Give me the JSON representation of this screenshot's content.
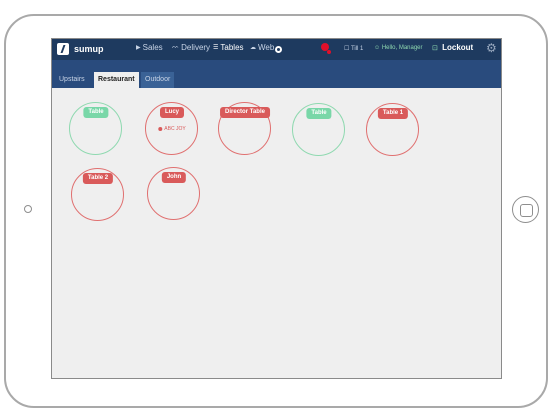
{
  "brand": {
    "logo_text": "sumup"
  },
  "nav": {
    "sales": "Sales",
    "delivery": "Delivery",
    "tables": "Tables",
    "web": "Web"
  },
  "status": {
    "till": "Till 1",
    "greeting": "Hello, Manager",
    "lockout": "Lockout"
  },
  "tabs": [
    "Upstairs",
    "Restaurant",
    "Outdoor"
  ],
  "active_tab": "Restaurant",
  "tables": [
    {
      "label": "Table",
      "state": "free"
    },
    {
      "label": "Lucy",
      "state": "occupied",
      "tag": "ABC JOY"
    },
    {
      "label": "Director Table",
      "state": "occupied"
    },
    {
      "label": "Table",
      "state": "free"
    },
    {
      "label": "Table 1",
      "state": "occupied"
    },
    {
      "label": "Table 2",
      "state": "occupied"
    },
    {
      "label": "John",
      "state": "occupied"
    }
  ],
  "colors": {
    "header": "#1e3a5f",
    "tabbar": "#294b7d",
    "free": "#79d7a8",
    "occupied": "#d95a5a",
    "alert": "#e0102a"
  },
  "icons": {
    "brand": "sumup-logo-icon",
    "sales": "play-icon",
    "delivery": "bike-icon",
    "tables": "list-icon",
    "web": "cloud-icon",
    "till": "register-icon",
    "user": "user-icon",
    "lockout": "lock-icon",
    "settings": "gear-icon"
  }
}
